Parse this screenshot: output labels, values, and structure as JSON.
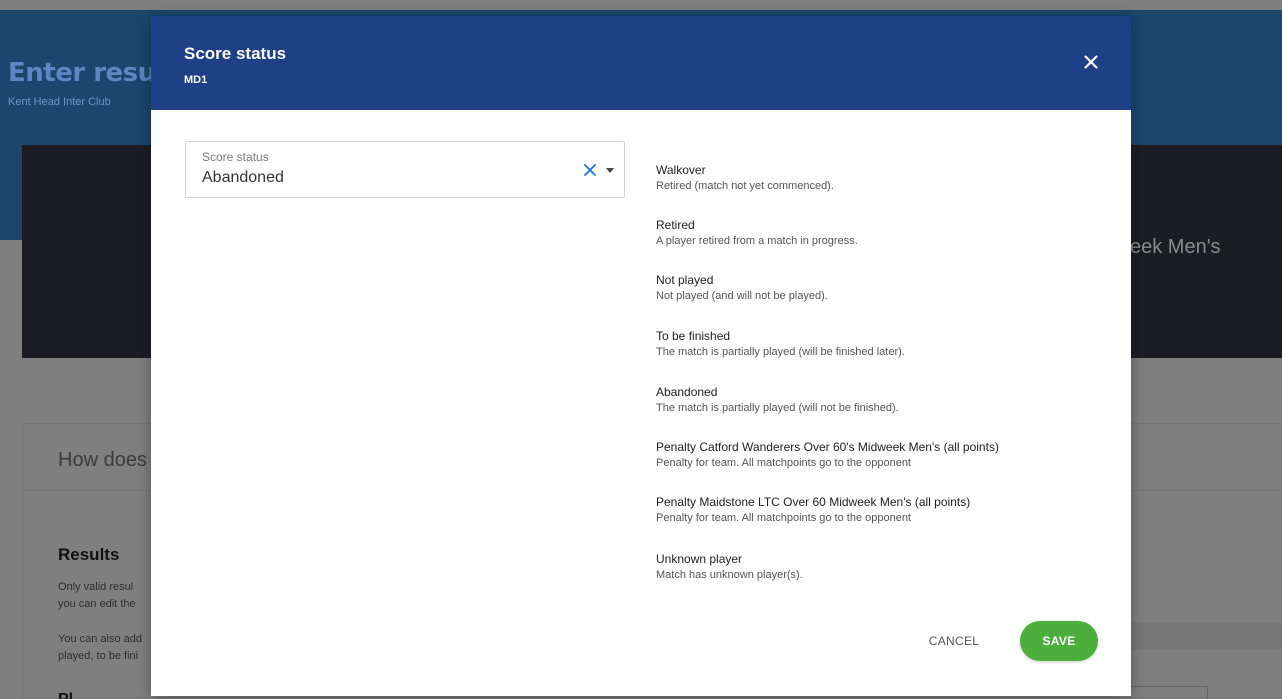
{
  "background": {
    "page_title": "Enter resul",
    "page_subtitle": "Kent Head Inter Club",
    "banner_text": "eek Men's",
    "how_heading": "How does",
    "results_heading": "Results",
    "results_line1": "Only valid resul",
    "results_line2": "you can edit the",
    "results_line3": "You can also add",
    "results_line4": "played, to be fini",
    "p_heading": "Pl"
  },
  "modal": {
    "title": "Score status",
    "subtitle": "MD1",
    "close_icon": "close-icon",
    "select": {
      "label": "Score status",
      "value": "Abandoned",
      "clear_icon": "clear-x-icon",
      "dropdown_icon": "caret-down-icon"
    },
    "statuses": [
      {
        "name": "Walkover",
        "description": "Retired (match not yet commenced)."
      },
      {
        "name": "Retired",
        "description": "A player retired from a match in progress."
      },
      {
        "name": "Not played",
        "description": "Not played (and will not be played)."
      },
      {
        "name": "To be finished",
        "description": "The match is partially played (will be finished later)."
      },
      {
        "name": "Abandoned",
        "description": "The match is partially played (will not be finished)."
      },
      {
        "name": "Penalty Catford Wanderers Over 60's Midweek Men's (all points)",
        "description": "Penalty for team. All matchpoints go to the opponent"
      },
      {
        "name": "Penalty Maidstone LTC Over 60 Midweek Men's (all points)",
        "description": "Penalty for team. All matchpoints go to the opponent"
      },
      {
        "name": "Unknown player",
        "description": "Match has unknown player(s)."
      }
    ],
    "cancel_label": "CANCEL",
    "save_label": "SAVE"
  },
  "colors": {
    "header": "#1f3f87",
    "save": "#4caf3c",
    "clear_x": "#1a73e8"
  }
}
